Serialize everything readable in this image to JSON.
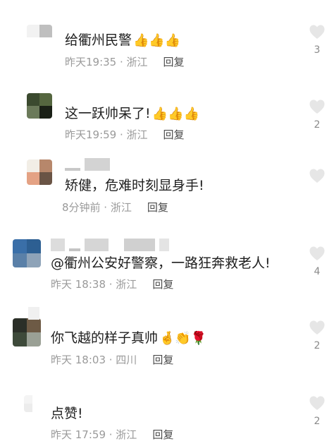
{
  "comments": [
    {
      "text": "给衢州民警",
      "emoji": "👍👍👍",
      "time": "昨天19:35 · 浙江",
      "reply": "回复",
      "likes": "3",
      "avatar_colors": [
        "#f2f2f2",
        "#bfbfbf",
        "#ffffff",
        "#ffffff"
      ]
    },
    {
      "text": "这一跃帅呆了!",
      "emoji": "👍👍👍",
      "time": "昨天19:59 · 浙江",
      "reply": "回复",
      "likes": "2",
      "avatar_colors": [
        "#3b4a2f",
        "#55663f",
        "#6b7a5a",
        "#1a2016"
      ]
    },
    {
      "text": "矫健，危难时刻显身手!",
      "emoji": "",
      "time": "8分钟前 · 浙江",
      "reply": "回复",
      "likes": "",
      "avatar_colors": [
        "#f2eee6",
        "#b7876b",
        "#e4a284",
        "#6a5445"
      ]
    },
    {
      "text": "@衢州公安好警察，一路狂奔救老人!",
      "emoji": "",
      "time": "昨天 18:38 · 浙江",
      "reply": "回复",
      "likes": "4",
      "avatar_colors": [
        "#3a6fa8",
        "#2d5f92",
        "#5a80a8",
        "#8ea3b8"
      ]
    },
    {
      "text": "你飞越的样子真帅",
      "emoji": "🤞👏🌹",
      "time": "昨天 18:03 · 四川",
      "reply": "回复",
      "likes": "2",
      "avatar_colors": [
        "#2b2f28",
        "#6d5a45",
        "#3e4a3a",
        "#9aa095"
      ]
    },
    {
      "text": "点赞!",
      "emoji": "",
      "time": "昨天 17:59 · 浙江",
      "reply": "回复",
      "likes": "2",
      "avatar_colors": [
        "#f4f4f4",
        "#ffffff",
        "#ececec",
        "#ffffff"
      ]
    }
  ]
}
